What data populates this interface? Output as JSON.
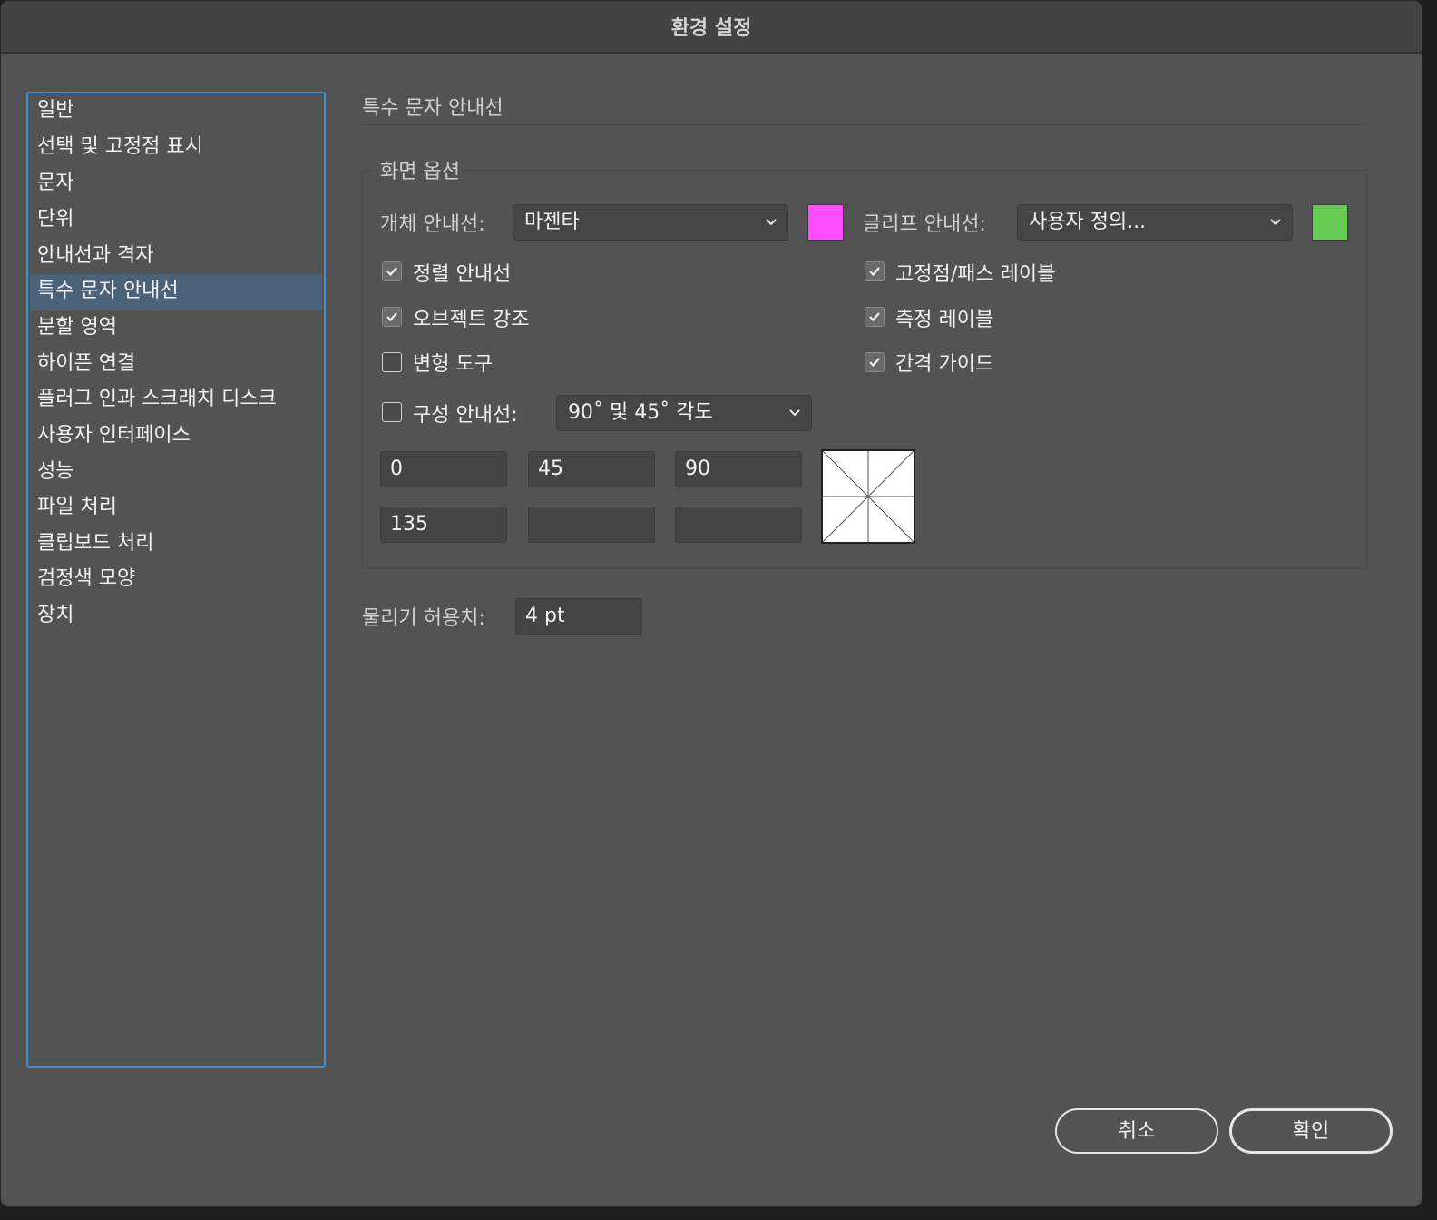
{
  "window": {
    "title": "환경 설정"
  },
  "sidebar": {
    "items": [
      {
        "label": "일반"
      },
      {
        "label": "선택 및 고정점 표시"
      },
      {
        "label": "문자"
      },
      {
        "label": "단위"
      },
      {
        "label": "안내선과 격자"
      },
      {
        "label": "특수 문자 안내선",
        "selected": true
      },
      {
        "label": "분할 영역"
      },
      {
        "label": "하이픈 연결"
      },
      {
        "label": "플러그 인과 스크래치 디스크"
      },
      {
        "label": "사용자 인터페이스"
      },
      {
        "label": "성능"
      },
      {
        "label": "파일 처리"
      },
      {
        "label": "클립보드 처리"
      },
      {
        "label": "검정색 모양"
      },
      {
        "label": "장치"
      }
    ]
  },
  "main": {
    "section_title": "특수 문자 안내선",
    "display_options": {
      "legend": "화면 옵션",
      "object_guides": {
        "label": "개체 안내선:",
        "value": "마젠타",
        "color": "#ff4dff"
      },
      "glyph_guides": {
        "label": "글리프 안내선:",
        "value": "사용자 정의...",
        "color": "#66cc55"
      },
      "checkboxes": {
        "alignment_guides": {
          "label": "정렬 안내선",
          "checked": true
        },
        "object_highlighting": {
          "label": "오브젝트 강조",
          "checked": true
        },
        "transform_tools": {
          "label": "변형 도구",
          "checked": false
        },
        "anchor_path_labels": {
          "label": "고정점/패스 레이블",
          "checked": true
        },
        "measurement_labels": {
          "label": "측정 레이블",
          "checked": true
        },
        "spacing_guides": {
          "label": "간격 가이드",
          "checked": true
        }
      },
      "construction_guides": {
        "label": "구성 안내선:",
        "checked": false,
        "value": "90˚ 및 45˚ 각도"
      },
      "angles": [
        "0",
        "45",
        "90",
        "135",
        "",
        ""
      ]
    },
    "snapping_tolerance": {
      "label": "물리기 허용치:",
      "value": "4 pt"
    }
  },
  "buttons": {
    "cancel": "취소",
    "ok": "확인"
  }
}
